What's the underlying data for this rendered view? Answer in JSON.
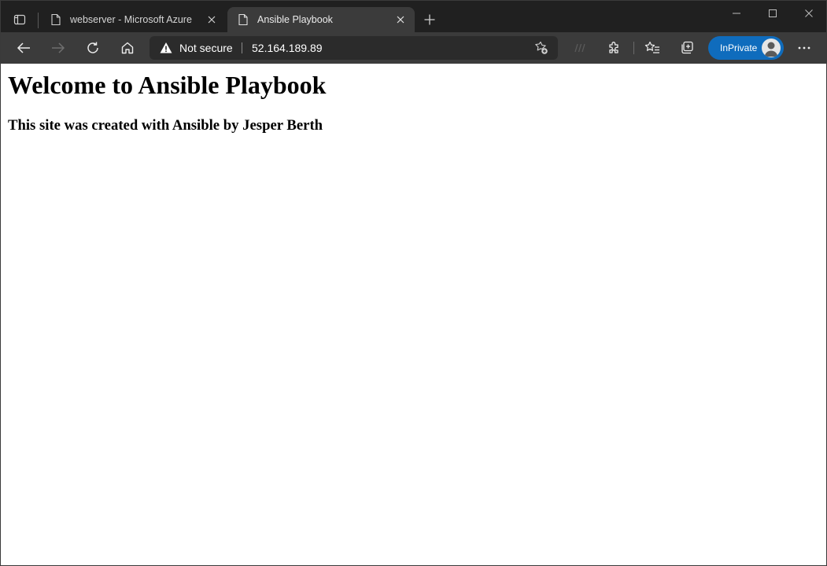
{
  "browser": {
    "tabs": [
      {
        "title": "webserver - Microsoft Azure",
        "active": false
      },
      {
        "title": "Ansible Playbook",
        "active": true
      }
    ],
    "address_bar": {
      "security_status": "Not secure",
      "url": "52.164.189.89"
    },
    "profile_button_label": "InPrivate",
    "colors": {
      "accent": "#0f6cbd",
      "chrome": "#202020",
      "toolbar": "#3b3b3b"
    },
    "icons": [
      "tab-actions-icon",
      "page-icon",
      "close-icon",
      "new-tab-icon",
      "minimize-icon",
      "maximize-icon",
      "close-window-icon",
      "back-icon",
      "forward-icon",
      "refresh-icon",
      "home-icon",
      "warning-icon",
      "add-favorite-icon",
      "read-aloud-icon",
      "extensions-icon",
      "favorites-icon",
      "collections-icon",
      "avatar",
      "more-icon"
    ]
  },
  "page": {
    "heading": "Welcome to Ansible Playbook",
    "subheading": "This site was created with Ansible by Jesper Berth"
  }
}
